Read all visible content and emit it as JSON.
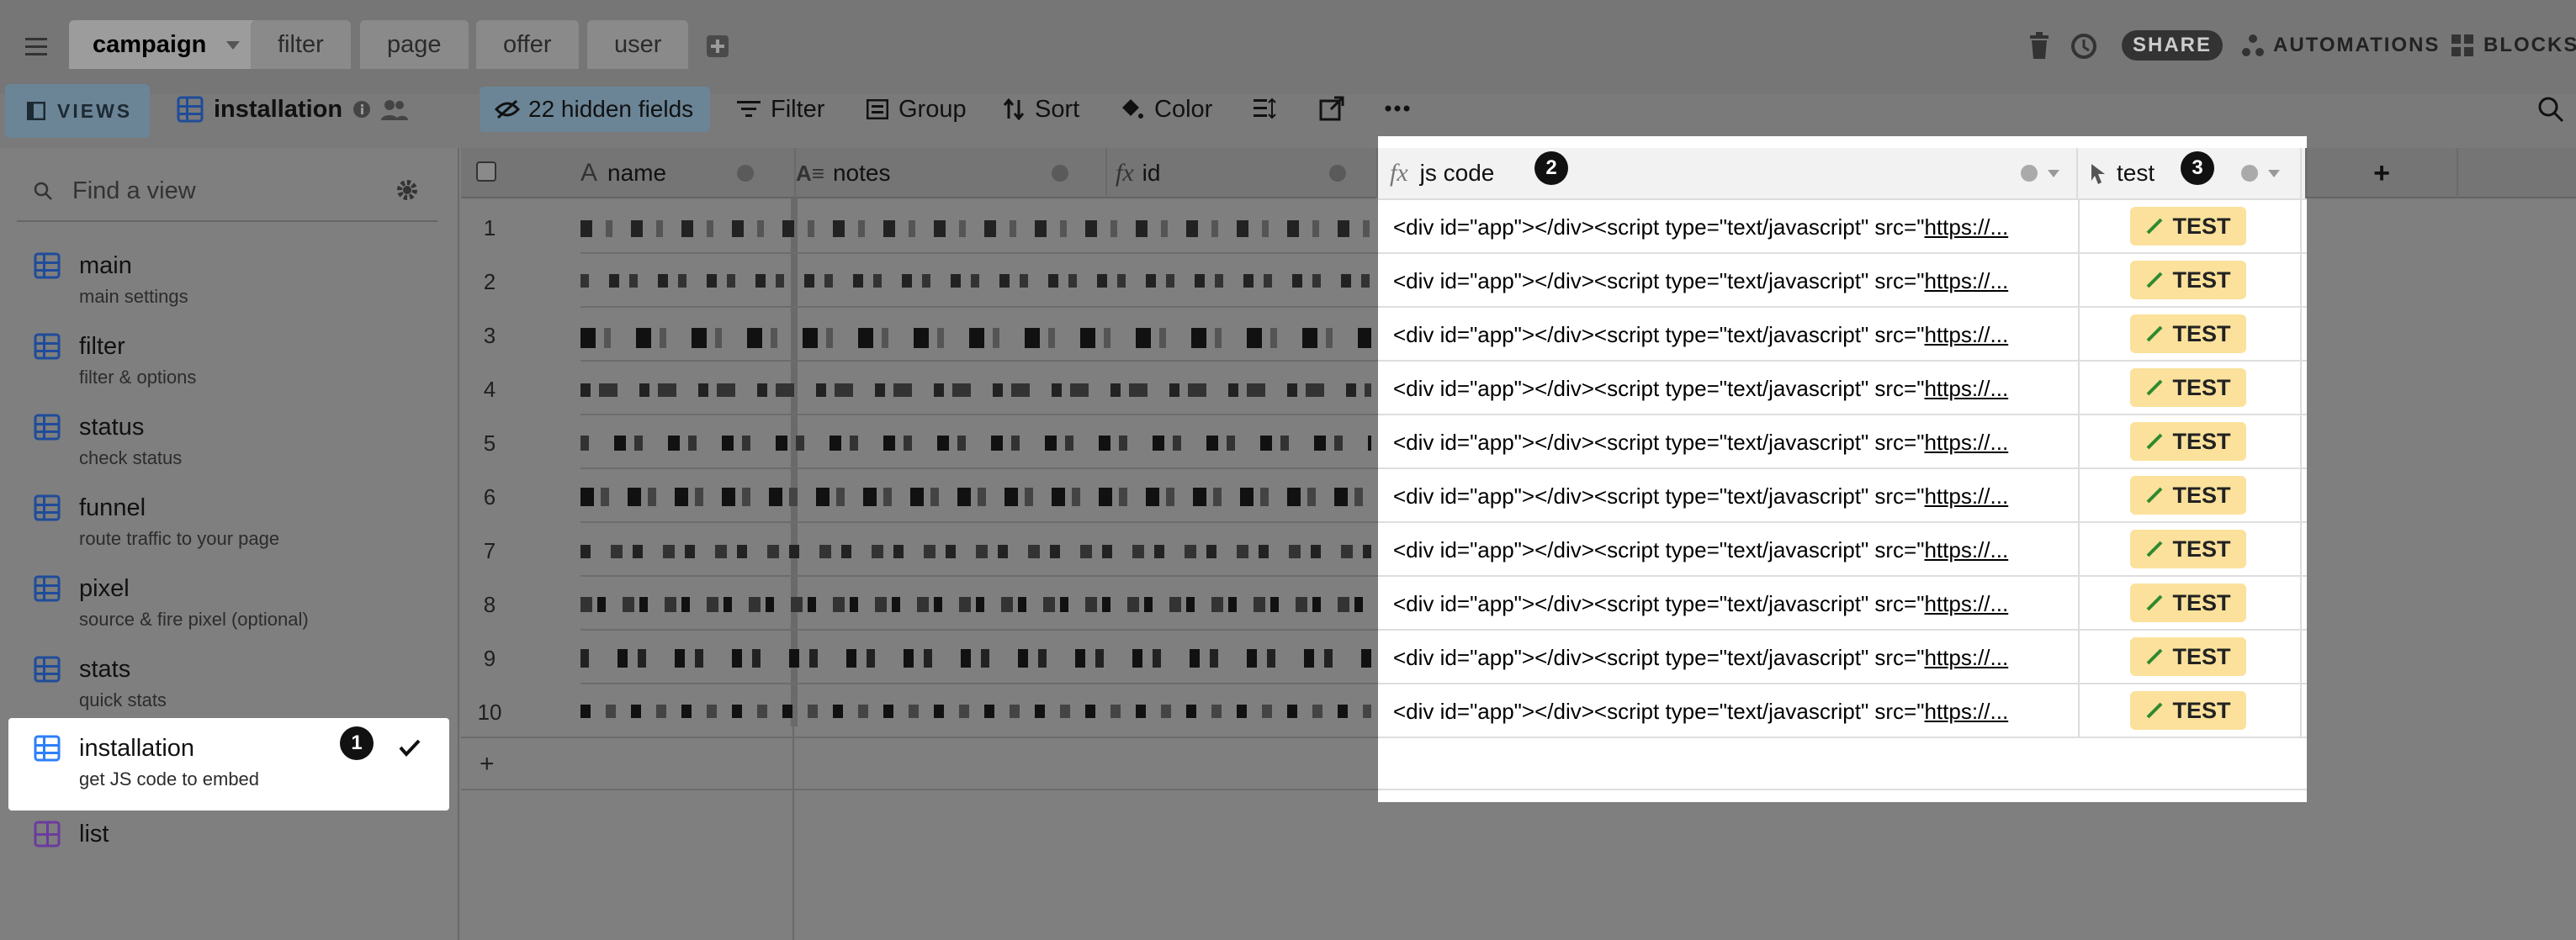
{
  "tabs": [
    {
      "label": "campaign",
      "active": true
    },
    {
      "label": "filter"
    },
    {
      "label": "page"
    },
    {
      "label": "offer"
    },
    {
      "label": "user"
    }
  ],
  "topright": {
    "share": "SHARE",
    "automations": "AUTOMATIONS",
    "blocks": "BLOCKS"
  },
  "viewbar": {
    "views": "VIEWS",
    "view_name": "installation",
    "hidden_fields": "22 hidden fields",
    "filter": "Filter",
    "group": "Group",
    "sort": "Sort",
    "color": "Color"
  },
  "sidebar": {
    "search_placeholder": "Find a view",
    "items": [
      {
        "title": "main",
        "sub": "main settings"
      },
      {
        "title": "filter",
        "sub": "filter & options"
      },
      {
        "title": "status",
        "sub": "check status"
      },
      {
        "title": "funnel",
        "sub": "route traffic to your page"
      },
      {
        "title": "pixel",
        "sub": "source & fire pixel (optional)"
      },
      {
        "title": "stats",
        "sub": "quick stats"
      },
      {
        "title": "installation",
        "sub": "get JS code to embed"
      },
      {
        "title": "list",
        "sub": ""
      }
    ]
  },
  "columns": {
    "name": "name",
    "notes": "notes",
    "id": "id",
    "jscode": "js code",
    "test": "test"
  },
  "rows": [
    "1",
    "2",
    "3",
    "4",
    "5",
    "6",
    "7",
    "8",
    "9",
    "10"
  ],
  "js_prefix": "<div id=\"app\"></div><script type=\"text/javascript\" src=\"",
  "js_link": "https://...",
  "test_label": "TEST",
  "badges": {
    "one": "1",
    "two": "2",
    "three": "3"
  },
  "colors": {
    "accent_blue": "#2d7ff9",
    "test_button": "#fbe19b",
    "dim_overlay": "#7f7f7f"
  }
}
